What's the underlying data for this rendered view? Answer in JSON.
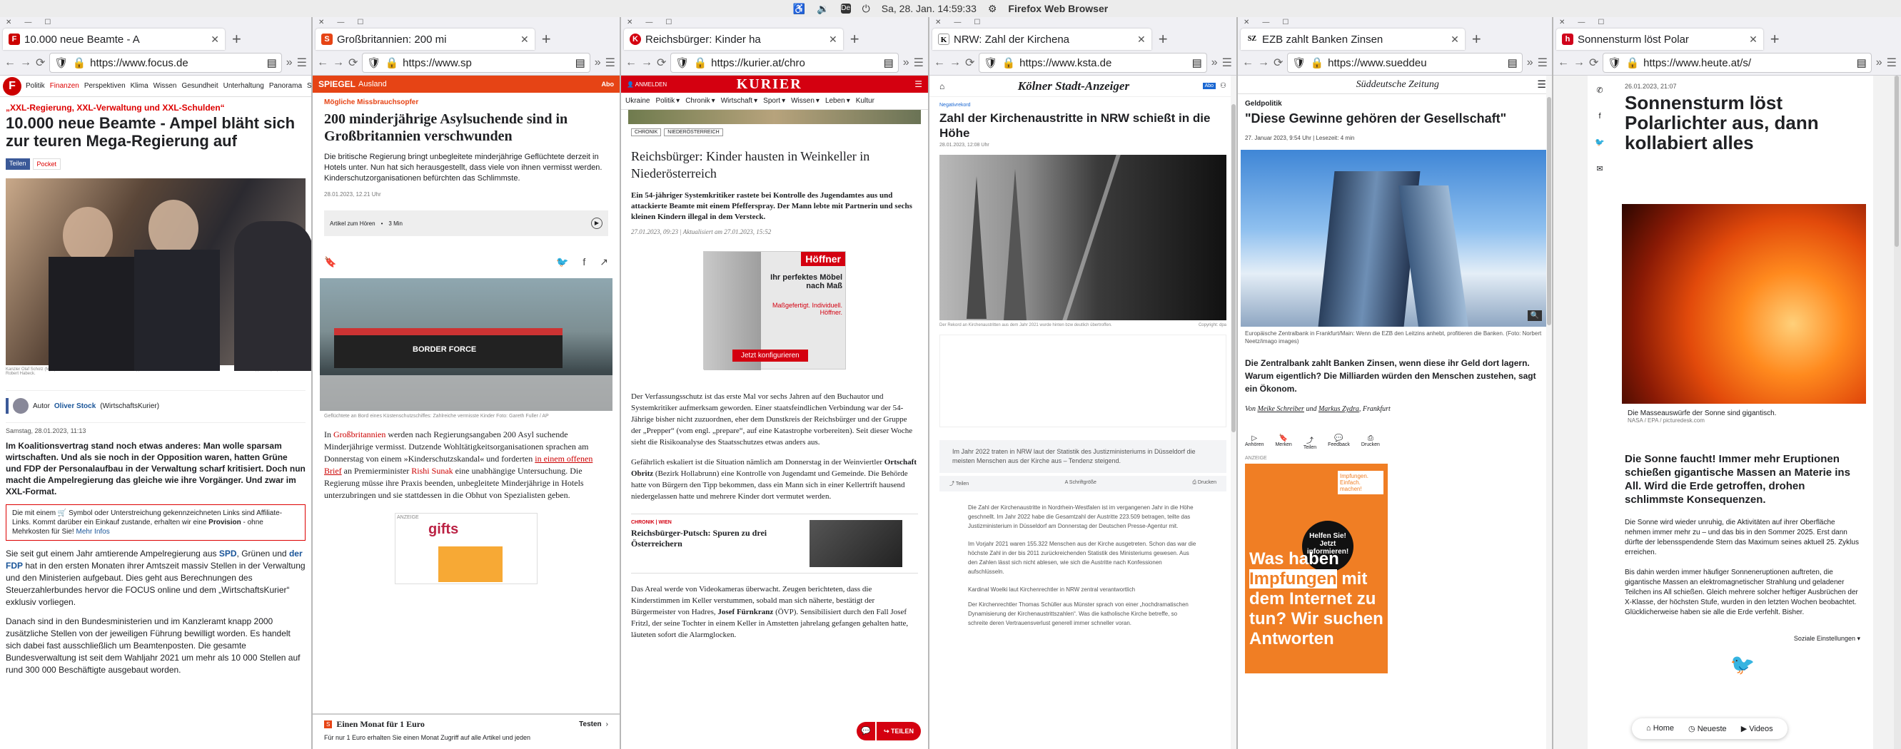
{
  "topbar": {
    "indicator": "De",
    "datetime": "Sa, 28. Jan. 14:59:33",
    "app": "Firefox Web Browser"
  },
  "windows": [
    {
      "tab": "10.000 neue Beamte - A",
      "url": "https://www.focus.de",
      "nav": [
        "Politik",
        "Finanzen",
        "Perspektiven",
        "Klima",
        "Wissen",
        "Gesundheit",
        "Unterhaltung",
        "Panorama",
        "Sp"
      ],
      "kicker": "„XXL-Regierung, XXL-Verwaltung und XXL-Schulden“",
      "title": "10.000 neue Beamte - Ampel bläht sich zur teuren Mega-Regierung auf",
      "share": "Teilen",
      "pocket": "Pocket",
      "caption": "Kanzler Olaf Scholz (M) spricht mit Finanzminister Christian Lindner (r) und Wirtschaftsminister Robert Habeck.",
      "credit": "Michael Kappeler/dpa/picture-alliance",
      "author_prefix": "Autor",
      "author": "Oliver Stock",
      "author_suffix": "(WirtschaftsKurier)",
      "date": "Samstag, 28.01.2023, 11:13",
      "lead": "Im Koalitionsvertrag stand noch etwas anderes: Man wolle sparsam wirtschaften. Und als sie noch in der Opposition waren, hatten Grüne und FDP der Personalaufbau in der Verwaltung scharf kritisiert. Doch nun macht die Ampelregierung das gleiche wie ihre Vorgänger. Und zwar im XXL-Format.",
      "notice_a": "Die mit einem",
      "notice_b": "Symbol oder Unterstreichung gekennzeichneten Links sind Affiliate-Links. Kommt darüber ein Einkauf zustande, erhalten wir eine",
      "notice_bold": "Provision",
      "notice_c": "- ohne Mehrkosten für Sie!",
      "notice_link": "Mehr Infos",
      "p1_a": "Sie seit gut einem Jahr amtierende Ampelregierung aus",
      "p1_spd": "SPD",
      "p1_b": ", Grünen und",
      "p1_fdp": "der FDP",
      "p1_c": "hat in den ersten Monaten ihrer Amtszeit massiv Stellen in der Verwaltung und den Ministerien aufgebaut. Dies geht aus Berechnungen des Steuerzahlerbundes hervor die FOCUS online und dem „WirtschaftsKurier“ exklusiv vorliegen.",
      "p2": "Danach sind in den Bundesministerien und im Kanzleramt knapp 2000 zusätzliche Stellen von der jeweiligen Führung bewilligt worden. Es handelt sich dabei fast ausschließlich um Beamtenposten. Die gesamte Bundesverwaltung ist seit dem Wahljahr 2021 um mehr als 10 000 Stellen auf rund 300 000 Beschäftigte ausgebaut worden."
    },
    {
      "tab": "Großbritannien: 200 mi",
      "url": "https://www.sp",
      "brand": "SPIEGEL",
      "section": "Ausland",
      "abo": "Abo",
      "kicker": "Mögliche Missbrauchsopfer",
      "title": "200 minderjährige Asylsuchende sind in Großbritannien verschwunden",
      "teaser": "Die britische Regierung bringt unbegleitete minderjährige Geflüchtete derzeit in Hotels unter. Nun hat sich herausgestellt, dass viele von ihnen vermisst werden. Kinderschutzorganisationen befürchten das Schlimmste.",
      "date": "28.01.2023, 12.21 Uhr",
      "audio": "Artikel zum Hören",
      "audio_len": "3 Min",
      "boat_text": "BORDER FORCE",
      "caption": "Geflüchtete an Bord eines Küstenschutzschiffes: Zahlreiche vermisste Kinder",
      "credit": "Foto: Gareth Fuller / AP",
      "p_a": "In",
      "p_link1": "Großbritannien",
      "p_b": "werden nach Regierungsangaben 200 Asyl suchende Minderjährige vermisst. Dutzende Wohltätigkeitsorganisationen sprachen am Donnerstag von einem »Kinderschutzskandal« und forderten",
      "p_link2": "in einem offenen Brief",
      "p_c": "an Premierminister",
      "p_link3": "Rishi Sunak",
      "p_d": "eine unabhängige Untersuchung. Die Regierung müsse ihre Praxis beenden, unbegleitete Minderjährige in Hotels unterzubringen und sie stattdessen in die Obhut von Spezialisten geben.",
      "ad_label": "ANZEIGE",
      "ad_brand": "gifts",
      "offer": "Einen Monat für 1 Euro",
      "offer_btn": "Testen",
      "offer_sub": "Für nur 1 Euro erhalten Sie einen Monat Zugriff auf alle Artikel und jeden"
    },
    {
      "tab": "Reichsbürger: Kinder ha",
      "url": "https://kurier.at/chro",
      "login": "ANMELDEN",
      "brand": "KURIER",
      "nav": [
        "Ukraine",
        "Politik",
        "Chronik",
        "Wirtschaft",
        "Sport",
        "Wissen",
        "Leben",
        "Kultur"
      ],
      "tag1": "CHRONIK",
      "tag2": "NIEDERÖSTERREICH",
      "title": "Reichsbürger: Kinder hausten in Weinkeller in Niederösterreich",
      "lead": "Ein 54-jähriger Systemkritiker rastete bei Kontrolle des Jugendamtes aus und attackierte Beamte mit einem Pfefferspray. Der Mann lebte mit Partnerin und sechs kleinen Kindern illegal in dem Versteck.",
      "date": "27.01.2023, 09:23 | Aktualisiert am 27.01.2023, 15:52",
      "ad_brand": "Höffner",
      "ad_text": "Ihr perfektes Möbel nach Maß",
      "ad_sub": "Maßgefertigt. Individuell. Höffner.",
      "ad_btn": "Jetzt konfigurieren",
      "p1": "Der Verfassungsschutz ist das erste Mal vor sechs Jahren auf den Buchautor und Systemkritiker aufmerksam geworden. Einer staatsfeindlichen Verbindung war der 54-Jährige bisher nicht zuzuordnen, eher dem Dunstkreis der Reichsbürger und der Gruppe der „Prepper“ (vom engl. „prepare“, auf eine Katastrophe vorbereiten). Seit dieser Woche sieht die Risikoanalyse des Staatsschutzes etwas anders aus.",
      "p2_a": "Gefährlich eskaliert ist die Situation nämlich am Donnerstag in der Weinviertler",
      "p2_b": "Ortschaft Obritz",
      "p2_c": "(Bezirk Hollabrunn) eine Kontrolle von Jugendamt und Gemeinde. Die Behörde hatte von Bürgern den Tipp bekommen, dass ein Mann sich in einer Kellertrift hausend niedergelassen hatte und mehrere Kinder dort vermutet werden.",
      "rel_tag": "CHRONIK | WIEN",
      "rel_title": "Reichsbürger-Putsch: Spuren zu drei Österreichern",
      "p3_a": "Das Areal werde von Videokameras überwacht. Zeugen berichteten, dass die Kinderstimmen im Keller verstummen, sobald man sich näherte, bestätigt der Bürgermeister von Hadres,",
      "p3_b": "Josef Fürnkranz",
      "p3_c": "(ÖVP). Sensibilisiert durch den Fall Josef Fritzl, der seine Tochter in einem Keller in Amstetten jahrelang gefangen gehalten hatte, läuteten sofort die Alarmglocken.",
      "share_btn": "TEILEN"
    },
    {
      "tab": "NRW: Zahl der Kirchena",
      "url": "https://www.ksta.de",
      "brand": "Kölner Stadt-Anzeiger",
      "abo": "Abo",
      "kicker": "Negativrekord",
      "title": "Zahl der Kirchenaustritte in NRW schießt in die Höhe",
      "date": "28.01.2023, 12:08 Uhr",
      "caption": "Der Rekord an Kirchenaustritten aus dem Jahr 2021 wurde hinten bzw deutlich übertroffen.",
      "credit": "Copyright: dpa",
      "lead": "Im Jahr 2022 traten in NRW laut der Statistik des Justizministeriums in Düsseldorf die meisten Menschen aus der Kirche aus – Tendenz steigend.",
      "actions": [
        "Teilen",
        "Schriftgröße",
        "Drucken"
      ],
      "p1": "Die Zahl der Kirchenaustritte in Nordrhein-Westfalen ist im vergangenen Jahr in die Höhe geschnellt. Im Jahr 2022 habe die Gesamtzahl der Austritte 223.509 betragen, teilte das Justizministerium in Düsseldorf am Donnerstag der Deutschen Presse-Agentur mit.",
      "p2": "Im Vorjahr 2021 waren 155.322 Menschen aus der Kirche ausgetreten. Schon das war die höchste Zahl in der bis 2011 zurückreichenden Statistik des Ministeriums gewesen. Aus den Zahlen lässt sich nicht ablesen, wie sich die Austritte nach Konfessionen aufschlüsseln.",
      "p3": "Kardinal Woelki laut Kirchenrechtler in NRW zentral verantwortlich",
      "p4": "Der Kirchenrechtler Thomas Schüller aus Münster sprach von einer „hochdramatischen Dynamisierung der Kirchenaustrittszahlen“. Was die katholische Kirche betreffe, so schreite deren Vertrauensverlust generell immer schneller voran."
    },
    {
      "tab": "EZB zahlt Banken Zinsen",
      "url": "https://www.sueddeu",
      "brand": "Süddeutsche Zeitung",
      "kicker": "Geldpolitik",
      "title": "\"Diese Gewinne gehören der Gesellschaft\"",
      "date": "27. Januar 2023, 9:54 Uhr",
      "readtime": "Lesezeit: 4 min",
      "caption": "Europäische Zentralbank in Frankfurt/Main: Wenn die EZB den Leitzins anhebt, profitieren die Banken.",
      "credit": "(Foto: Norbert Neetz/imago images)",
      "lead": "Die Zentralbank zahlt Banken Zinsen, wenn diese ihr Geld dort lagern. Warum eigentlich? Die Milliarden würden den Menschen zustehen, sagt ein Ökonom.",
      "byline_a": "Von",
      "author1": "Meike Schreiber",
      "byline_b": "und",
      "author2": "Markus Zydra",
      "byline_c": ", Frankfurt",
      "actions": [
        "Anhören",
        "Merken",
        "Teilen",
        "Feedback",
        "Drucken"
      ],
      "ad_label": "ANZEIGE",
      "ad_head_a": "Was haben",
      "ad_head_hl": "Impfungen",
      "ad_head_b": "mit dem Internet zu tun?",
      "ad_head_c": "Wir suchen Antworten",
      "ad_badge": "Helfen Sie! Jetzt informieren!",
      "ad_small": "Impfungen. Einfach. machen!"
    },
    {
      "tab": "Sonnensturm löst Polar",
      "url": "https://www.heute.at/s/",
      "date": "26.01.2023, 21:07",
      "title": "Sonnensturm löst Polarlichter aus, dann kollabiert alles",
      "caption": "Die Masseauswürfe der Sonne sind gigantisch.",
      "credit": "NASA / EPA / picturedesk.com",
      "lead": "Die Sonne faucht! Immer mehr Eruptionen schießen gigantische Massen an Materie ins All. Wird die Erde getroffen, drohen schlimmste Konsequenzen.",
      "p1": "Die Sonne wird wieder unruhig, die Aktivitäten auf ihrer Oberfläche nehmen immer mehr zu – und das bis in den Sommer 2025. Erst dann dürfte der lebensspendende Stern das Maximum seines aktuell 25. Zyklus erreichen.",
      "p2": "Bis dahin werden immer häufiger Sonneneruptionen auftreten, die gigantische Massen an elektromagnetischer Strahlung und geladener Teilchen ins All schießen. Gleich mehrere solcher heftiger Ausbrüchen der X-Klasse, der höchsten Stufe, wurden in den letzten Wochen beobachtet. Glücklicherweise haben sie alle die Erde verfehlt. Bisher.",
      "social": "Soziale Einstellungen",
      "bottom": [
        "Home",
        "Neueste",
        "Videos"
      ]
    }
  ],
  "colors": {
    "focus_red": "#d00",
    "spiegel_red": "#e64415",
    "kurier_red": "#d40010",
    "sz_blue": "#003d7a",
    "heute_red": "#d0021b"
  }
}
